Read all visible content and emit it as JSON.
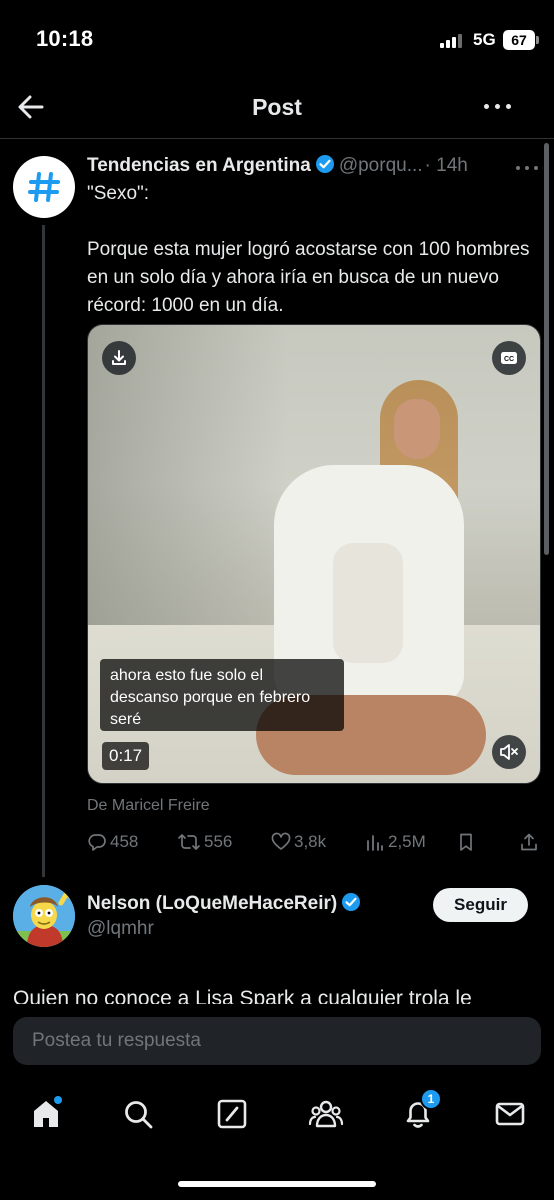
{
  "status_bar": {
    "time": "10:18",
    "network": "5G",
    "battery": "67"
  },
  "nav": {
    "title": "Post"
  },
  "tweet": {
    "display_name": "Tendencias en Argentina",
    "handle": "@porqu...",
    "time": "· 14h",
    "text": "\"Sexo\":\n\nPorque esta mujer logró acostarse con 100 hombres en un solo día y ahora iría en busca de un nuevo récord: 1000 en un día.",
    "video": {
      "caption": " ahora esto fue solo el\ndescanso porque en febrero\nseré",
      "duration": "0:17"
    },
    "attribution": "De Maricel Freire",
    "stats": {
      "replies": "458",
      "reposts": "556",
      "likes": "3,8k",
      "views": "2,5M"
    }
  },
  "reply": {
    "display_name": "Nelson (LoQueMeHaceReir)",
    "handle": "@lqmhr",
    "follow_label": "Seguir",
    "text": "Quien no conoce a Lisa Spark a cualquier trola le"
  },
  "composer": {
    "placeholder": "Postea tu respuesta"
  },
  "tabbar": {
    "notifications_badge": "1"
  },
  "colors": {
    "accent": "#1d9bf0",
    "background": "#000000",
    "muted": "#71767b",
    "text": "#e7e9ea"
  }
}
